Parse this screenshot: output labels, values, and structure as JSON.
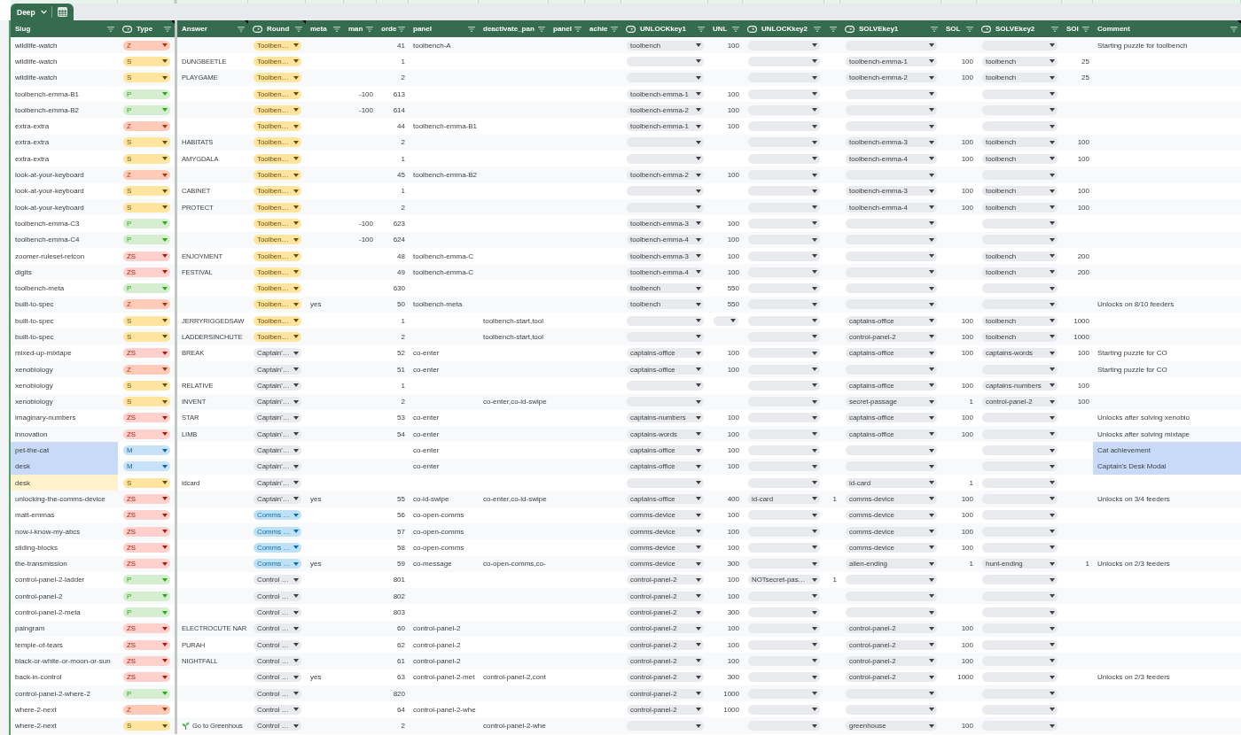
{
  "table_tab": {
    "name": "Deep"
  },
  "table": {
    "columns": [
      {
        "label": "Slug",
        "kind": "text",
        "note": false
      },
      {
        "label": "Type",
        "kind": "dropdown",
        "note": true
      },
      {
        "label": "Answer",
        "kind": "text",
        "note": true
      },
      {
        "label": "Round",
        "kind": "dropdown",
        "note": true
      },
      {
        "label": "meta",
        "kind": "text",
        "note": false
      },
      {
        "label": "man",
        "kind": "number",
        "note": false
      },
      {
        "label": "orde",
        "kind": "number",
        "note": false
      },
      {
        "label": "panel",
        "kind": "text",
        "note": false
      },
      {
        "label": "deactivate_pan",
        "kind": "text",
        "note": false
      },
      {
        "label": "panel",
        "kind": "text",
        "note": false
      },
      {
        "label": "achie",
        "kind": "text",
        "note": false
      },
      {
        "label": "UNLOCKkey1",
        "kind": "dropdown",
        "note": false
      },
      {
        "label": "UNL",
        "kind": "number",
        "note": false
      },
      {
        "label": "UNLOCKkey2",
        "kind": "dropdown",
        "note": false
      },
      {
        "kind": "number",
        "note": false
      },
      {
        "label": "SOLVEkey1",
        "kind": "dropdown",
        "note": false
      },
      {
        "label": "SOL",
        "kind": "number",
        "note": false
      },
      {
        "label": "SOLVEkey2",
        "kind": "dropdown",
        "note": false
      },
      {
        "label": "SOI",
        "kind": "number",
        "note": false
      },
      {
        "label": "Comment",
        "kind": "text",
        "note": true
      }
    ],
    "rows": [
      {
        "slug": "wildlife-watch",
        "type": {
          "text": "Z",
          "color": "#ffcbb8"
        },
        "round": {
          "text": "Toolben…",
          "color": "#ffe59f"
        },
        "column_7": "41",
        "panel": "toolbench-A",
        "unlockkey1": "toolbench",
        "column_13": "100",
        "comment": "Starting puzzle for toolbench"
      },
      {
        "slug": "wildlife-watch",
        "type": {
          "text": "S",
          "color": "#ffe59f"
        },
        "answer": "DUNGBEETLE",
        "round": {
          "text": "Toolben…",
          "color": "#ffe59f"
        },
        "column_7": "1",
        "solvekey1": "toolbench-emma-1",
        "column_17": "100",
        "solvekey2": "toolbench",
        "column_19": "25"
      },
      {
        "slug": "wildlife-watch",
        "type": {
          "text": "S",
          "color": "#ffe59f"
        },
        "answer": "PLAYGAME",
        "round": {
          "text": "Toolben…",
          "color": "#ffe59f"
        },
        "column_7": "2",
        "solvekey1": "toolbench-emma-2",
        "column_17": "100",
        "solvekey2": "toolbench",
        "column_19": "25"
      },
      {
        "slug": "toolbench-emma-B1",
        "type": {
          "text": "P",
          "color": "#d4eecf"
        },
        "round": {
          "text": "Toolben…",
          "color": "#ffe59f"
        },
        "column_6": "-100",
        "column_7": "613",
        "unlockkey1": "toolbench-emma-1",
        "column_13": "100"
      },
      {
        "slug": "toolbench-emma-B2",
        "type": {
          "text": "P",
          "color": "#d4eecf"
        },
        "round": {
          "text": "Toolben…",
          "color": "#ffe59f"
        },
        "column_6": "-100",
        "column_7": "614",
        "unlockkey1": "toolbench-emma-2",
        "column_13": "100"
      },
      {
        "slug": "extra-extra",
        "type": {
          "text": "Z",
          "color": "#ffcbb8"
        },
        "round": {
          "text": "Toolben…",
          "color": "#ffe59f"
        },
        "column_7": "44",
        "panel": "toolbench-emma-B1",
        "unlockkey1": "toolbench-emma-1",
        "column_13": "100"
      },
      {
        "slug": "extra-extra",
        "type": {
          "text": "S",
          "color": "#ffe59f"
        },
        "answer": "HABITATS",
        "round": {
          "text": "Toolben…",
          "color": "#ffe59f"
        },
        "column_7": "2",
        "solvekey1": "toolbench-emma-3",
        "column_17": "100",
        "solvekey2": "toolbench",
        "column_19": "100"
      },
      {
        "slug": "extra-extra",
        "type": {
          "text": "S",
          "color": "#ffe59f"
        },
        "answer": "AMYGDALA",
        "round": {
          "text": "Toolben…",
          "color": "#ffe59f"
        },
        "column_7": "1",
        "solvekey1": "toolbench-emma-4",
        "column_17": "100",
        "solvekey2": "toolbench",
        "column_19": "100"
      },
      {
        "slug": "look-at-your-keyboard",
        "type": {
          "text": "Z",
          "color": "#ffcbb8"
        },
        "round": {
          "text": "Toolben…",
          "color": "#ffe59f"
        },
        "column_7": "45",
        "panel": "toolbench-emma-B2",
        "unlockkey1": "toolbench-emma-2",
        "column_13": "100"
      },
      {
        "slug": "look-at-your-keyboard",
        "type": {
          "text": "S",
          "color": "#ffe59f"
        },
        "answer": "CABINET",
        "round": {
          "text": "Toolben…",
          "color": "#ffe59f"
        },
        "column_7": "1",
        "solvekey1": "toolbench-emma-3",
        "column_17": "100",
        "solvekey2": "toolbench",
        "column_19": "100"
      },
      {
        "slug": "look-at-your-keyboard",
        "type": {
          "text": "S",
          "color": "#ffe59f"
        },
        "answer": "PROTECT",
        "round": {
          "text": "Toolben…",
          "color": "#ffe59f"
        },
        "column_7": "2",
        "solvekey1": "toolbench-emma-4",
        "column_17": "100",
        "solvekey2": "toolbench",
        "column_19": "100"
      },
      {
        "slug": "toolbench-emma-C3",
        "type": {
          "text": "P",
          "color": "#d4eecf"
        },
        "round": {
          "text": "Toolben…",
          "color": "#ffe59f"
        },
        "column_6": "-100",
        "column_7": "623",
        "unlockkey1": "toolbench-emma-3",
        "column_13": "100"
      },
      {
        "slug": "toolbench-emma-C4",
        "type": {
          "text": "P",
          "color": "#d4eecf"
        },
        "round": {
          "text": "Toolben…",
          "color": "#ffe59f"
        },
        "column_6": "-100",
        "column_7": "624",
        "unlockkey1": "toolbench-emma-4",
        "column_13": "100"
      },
      {
        "slug": "zoomer-ruleset-retcon",
        "type": {
          "text": "ZS",
          "color": "#ffd0cc"
        },
        "answer": "ENJOYMENT",
        "round": {
          "text": "Toolben…",
          "color": "#ffe59f"
        },
        "column_7": "48",
        "panel": "toolbench-emma-C",
        "unlockkey1": "toolbench-emma-3",
        "column_13": "100",
        "solvekey2": "toolbench",
        "column_19": "200"
      },
      {
        "slug": "digits",
        "type": {
          "text": "ZS",
          "color": "#ffd0cc"
        },
        "answer": "FESTIVAL",
        "round": {
          "text": "Toolben…",
          "color": "#ffe59f"
        },
        "column_7": "49",
        "panel": "toolbench-emma-C",
        "unlockkey1": "toolbench-emma-4",
        "column_13": "100",
        "solvekey2": "toolbench",
        "column_19": "200"
      },
      {
        "slug": "toolbench-meta",
        "type": {
          "text": "P",
          "color": "#d4eecf"
        },
        "round": {
          "text": "Toolben…",
          "color": "#ffe59f"
        },
        "column_7": "630",
        "unlockkey1": "toolbench",
        "column_13": "550"
      },
      {
        "slug": "built-to-spec",
        "type": {
          "text": "Z",
          "color": "#ffcbb8"
        },
        "round": {
          "text": "Toolben…",
          "color": "#ffe59f"
        },
        "meta": "yes",
        "column_7": "50",
        "panel": "toolbench-meta",
        "unlockkey1": "toolbench",
        "column_13": "550",
        "comment": "Unlocks on 8/10 feeders"
      },
      {
        "slug": "built-to-spec",
        "type": {
          "text": "S",
          "color": "#ffe59f"
        },
        "answer": "JERRYRIGGEDSAW",
        "round": {
          "text": "Toolben…",
          "color": "#ffe59f"
        },
        "column_7": "1",
        "column_9": "toolbench-start,tool",
        "column_13": {
          "kind": "dropdown"
        },
        "solvekey1": "captains-office",
        "column_17": "100",
        "solvekey2": "toolbench",
        "column_19": "1000"
      },
      {
        "slug": "built-to-spec",
        "type": {
          "text": "S",
          "color": "#ffe59f"
        },
        "answer": "LADDERSINCHUTE",
        "round": {
          "text": "Toolben…",
          "color": "#ffe59f"
        },
        "column_7": "2",
        "column_9": "toolbench-start,tool",
        "solvekey1": "control-panel-2",
        "column_17": "100",
        "solvekey2": "toolbench",
        "column_19": "1000"
      },
      {
        "slug": "mixed-up-mixtape",
        "type": {
          "text": "ZS",
          "color": "#ffd0cc"
        },
        "answer": "BREAK",
        "round": {
          "text": "Captain'…",
          "color": "#e8eaed"
        },
        "column_7": "52",
        "panel": "co-enter",
        "unlockkey1": "captains-office",
        "column_13": "100",
        "solvekey1": "captains-office",
        "column_17": "100",
        "solvekey2": "captains-words",
        "column_19": "100",
        "comment": "Starting puzzle for CO"
      },
      {
        "slug": "xenobiology",
        "type": {
          "text": "Z",
          "color": "#ffcbb8"
        },
        "round": {
          "text": "Captain'…",
          "color": "#e8eaed"
        },
        "column_7": "51",
        "panel": "co-enter",
        "unlockkey1": "captains-office",
        "column_13": "100",
        "comment": "Starting puzzle for CO"
      },
      {
        "slug": "xenobiology",
        "type": {
          "text": "S",
          "color": "#ffe59f"
        },
        "answer": "RELATIVE",
        "round": {
          "text": "Captain'…",
          "color": "#e8eaed"
        },
        "column_7": "1",
        "solvekey1": "captains-office",
        "column_17": "100",
        "solvekey2": "captains-numbers",
        "column_19": "100"
      },
      {
        "slug": "xenobiology",
        "type": {
          "text": "S",
          "color": "#ffe59f"
        },
        "answer": "INVENT",
        "round": {
          "text": "Captain'…",
          "color": "#e8eaed"
        },
        "column_7": "2",
        "column_9": "co-enter,co-id-swipe",
        "solvekey1": "secret-passage",
        "column_17": "1",
        "solvekey2": "control-panel-2",
        "column_19": "100"
      },
      {
        "slug": "imaginary-numbers",
        "type": {
          "text": "ZS",
          "color": "#ffd0cc"
        },
        "answer": "STAR",
        "round": {
          "text": "Captain'…",
          "color": "#e8eaed"
        },
        "column_7": "53",
        "panel": "co-enter",
        "unlockkey1": "captains-numbers",
        "column_13": "100",
        "solvekey1": "captains-office",
        "column_17": "100",
        "comment": "Unlocks after solving xenobio"
      },
      {
        "slug": "innovation",
        "type": {
          "text": "ZS",
          "color": "#ffd0cc"
        },
        "answer": "LIMB",
        "round": {
          "text": "Captain'…",
          "color": "#e8eaed"
        },
        "column_7": "54",
        "panel": "co-enter",
        "unlockkey1": "captains-words",
        "column_13": "100",
        "solvekey1": "captains-office",
        "column_17": "100",
        "comment": "Unlocks after solving mixtape"
      },
      {
        "slug": {
          "text": "pet-the-cat",
          "color": "#c9daf8"
        },
        "type": {
          "text": "M",
          "color": "#c7e2f8"
        },
        "round": {
          "text": "Captain'…",
          "color": "#e8eaed"
        },
        "panel": "co-enter",
        "unlockkey1": "captains-office",
        "column_13": "100",
        "comment": {
          "text": "Cat achievement",
          "color": "#c9daf8"
        }
      },
      {
        "slug": {
          "text": "desk",
          "color": "#c9daf8"
        },
        "type": {
          "text": "M",
          "color": "#c7e2f8"
        },
        "round": {
          "text": "Captain'…",
          "color": "#e8eaed"
        },
        "panel": "co-enter",
        "unlockkey1": "captains-office",
        "column_13": "100",
        "comment": {
          "text": "Captain's Desk Modal",
          "color": "#c9daf8"
        }
      },
      {
        "slug": {
          "text": "desk",
          "color": "#fff2cc"
        },
        "type": {
          "text": "S",
          "color": "#ffe59f"
        },
        "answer": "idcard",
        "round": {
          "text": "Captain'…",
          "color": "#e8eaed"
        },
        "solvekey1": "id-card",
        "column_17": "1"
      },
      {
        "slug": "unlocking-the-comms-device",
        "type": {
          "text": "ZS",
          "color": "#ffd0cc"
        },
        "round": {
          "text": "Captain'…",
          "color": "#e8eaed"
        },
        "meta": "yes",
        "column_7": "55",
        "panel": "co-id-swipe",
        "column_9": "co-enter,co-id-swipe",
        "unlockkey1": "captains-office",
        "column_13": "400",
        "unlockkey2": "id-card",
        "column_15": "1",
        "solvekey1": "comms-device",
        "column_17": "100",
        "comment": "Unlocks on 3/4 feeders"
      },
      {
        "slug": "matt-emmas",
        "type": {
          "text": "ZS",
          "color": "#ffd0cc"
        },
        "round": {
          "text": "Comms …",
          "color": "#bfe1f6"
        },
        "column_7": "56",
        "panel": "co-open-comms",
        "unlockkey1": "comms-device",
        "column_13": "100",
        "solvekey1": "comms-device",
        "column_17": "100"
      },
      {
        "slug": "now-i-know-my-abcs",
        "type": {
          "text": "ZS",
          "color": "#ffd0cc"
        },
        "round": {
          "text": "Comms …",
          "color": "#bfe1f6"
        },
        "column_7": "57",
        "panel": "co-open-comms",
        "unlockkey1": "comms-device",
        "column_13": "100",
        "solvekey1": "comms-device",
        "column_17": "100"
      },
      {
        "slug": "sliding-blocks",
        "type": {
          "text": "ZS",
          "color": "#ffd0cc"
        },
        "round": {
          "text": "Comms …",
          "color": "#bfe1f6"
        },
        "column_7": "58",
        "panel": "co-open-comms",
        "unlockkey1": "comms-device",
        "column_13": "100",
        "solvekey1": "comms-device",
        "column_17": "100"
      },
      {
        "slug": "the-transmission",
        "type": {
          "text": "ZS",
          "color": "#ffd0cc"
        },
        "round": {
          "text": "Comms …",
          "color": "#bfe1f6"
        },
        "meta": "yes",
        "column_7": "59",
        "panel": "co-message",
        "column_9": "co-open-comms,co-",
        "unlockkey1": "comms-device",
        "column_13": "300",
        "solvekey1": "alien-ending",
        "column_17": "1",
        "solvekey2": "hunt-ending",
        "column_19": "1",
        "comment": "Unlocks on 2/3 feeders"
      },
      {
        "slug": "control-panel-2-ladder",
        "type": {
          "text": "P",
          "color": "#d4eecf"
        },
        "round": {
          "text": "Control …",
          "color": "#e8eaed"
        },
        "column_7": "801",
        "unlockkey1": "control-panel-2",
        "column_13": "100",
        "unlockkey2": "NOTsecret-pas…",
        "column_15": "1"
      },
      {
        "slug": "control-panel-2",
        "type": {
          "text": "P",
          "color": "#d4eecf"
        },
        "round": {
          "text": "Control …",
          "color": "#e8eaed"
        },
        "column_7": "802",
        "unlockkey1": "control-panel-2",
        "column_13": "100"
      },
      {
        "slug": "control-panel-2-meta",
        "type": {
          "text": "P",
          "color": "#d4eecf"
        },
        "round": {
          "text": "Control …",
          "color": "#e8eaed"
        },
        "column_7": "803",
        "unlockkey1": "control-panel-2",
        "column_13": "300"
      },
      {
        "slug": "paingram",
        "type": {
          "text": "ZS",
          "color": "#ffd0cc"
        },
        "answer": "ELECTROCUTE NAR",
        "round": {
          "text": "Control …",
          "color": "#e8eaed"
        },
        "column_7": "60",
        "panel": "control-panel-2",
        "unlockkey1": "control-panel-2",
        "column_13": "100",
        "solvekey1": "control-panel-2",
        "column_17": "100"
      },
      {
        "slug": "temple-of-tears",
        "type": {
          "text": "ZS",
          "color": "#ffd0cc"
        },
        "answer": "PURAH",
        "round": {
          "text": "Control …",
          "color": "#e8eaed"
        },
        "column_7": "62",
        "panel": "control-panel-2",
        "unlockkey1": "control-panel-2",
        "column_13": "100",
        "solvekey1": "control-panel-2",
        "column_17": "100"
      },
      {
        "slug": "black-or-white-or-moon-or-sun",
        "type": {
          "text": "ZS",
          "color": "#ffd0cc"
        },
        "answer": "NIGHTFALL",
        "round": {
          "text": "Control …",
          "color": "#e8eaed"
        },
        "column_7": "61",
        "panel": "control-panel-2",
        "unlockkey1": "control-panel-2",
        "column_13": "100",
        "solvekey1": "control-panel-2",
        "column_17": "100"
      },
      {
        "slug": "back-in-control",
        "type": {
          "text": "ZS",
          "color": "#ffd0cc"
        },
        "round": {
          "text": "Control …",
          "color": "#e8eaed"
        },
        "meta": "yes",
        "column_7": "63",
        "panel": "control-panel-2-met",
        "column_9": "control-panel-2,cont",
        "unlockkey1": "control-panel-2",
        "column_13": "300",
        "solvekey1": "control-panel-2",
        "column_17": "1000",
        "comment": "Unlocks on 2/3 feeders"
      },
      {
        "slug": "control-panel-2-where-2",
        "type": {
          "text": "P",
          "color": "#d4eecf"
        },
        "round": {
          "text": "Control …",
          "color": "#e8eaed"
        },
        "column_7": "820",
        "unlockkey1": "control-panel-2",
        "column_13": "1000"
      },
      {
        "slug": "where-2-next",
        "type": {
          "text": "Z",
          "color": "#ffcbb8"
        },
        "round": {
          "text": "Control …",
          "color": "#e8eaed"
        },
        "column_7": "64",
        "panel": "control-panel-2-whe",
        "unlockkey1": "control-panel-2",
        "column_13": "1000"
      },
      {
        "slug": "where-2-next",
        "type": {
          "text": "S",
          "color": "#ffe59f"
        },
        "answer": {
          "kind": "link",
          "text": "Go to Greenhous"
        },
        "round": {
          "text": "Control …",
          "color": "#e8eaed"
        },
        "column_7": "2",
        "column_9": "control-panel-2-whe",
        "solvekey1": "greenhouse",
        "column_17": "100"
      }
    ]
  }
}
